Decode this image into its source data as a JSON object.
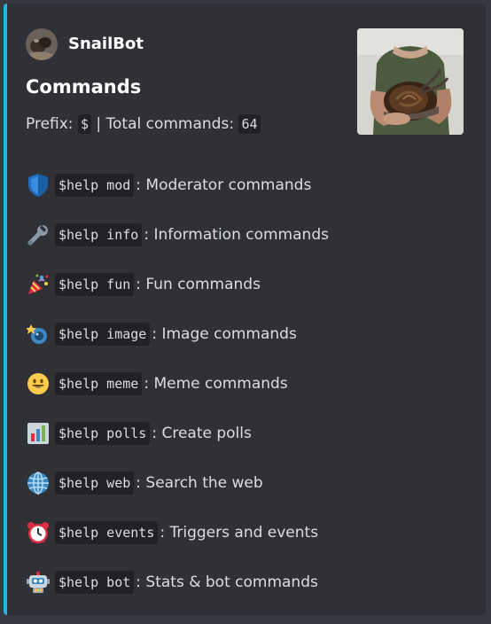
{
  "colors": {
    "background": "#36393f",
    "embed_background": "#2f3136",
    "accent": "#23b4e6",
    "code_background": "#202225",
    "text": "#dcddde",
    "title": "#ffffff"
  },
  "author": {
    "name": "SnailBot",
    "avatar_icon": "snail-avatar"
  },
  "embed": {
    "title": "Commands",
    "prefix_label": "Prefix:",
    "prefix_value": "$",
    "separator": "| Total commands:",
    "total_commands": "64",
    "thumbnail": "snail-photo"
  },
  "commands": [
    {
      "icon": "shield-icon",
      "code": "$help mod",
      "description": ": Moderator commands"
    },
    {
      "icon": "wrench-icon",
      "code": "$help info",
      "description": ": Information commands"
    },
    {
      "icon": "party-popper-icon",
      "code": "$help fun",
      "description": ": Fun commands"
    },
    {
      "icon": "camera-flash-icon",
      "code": "$help image",
      "description": ": Image commands"
    },
    {
      "icon": "smiley-icon",
      "code": "$help meme",
      "description": ": Meme commands"
    },
    {
      "icon": "bar-chart-icon",
      "code": "$help polls",
      "description": ": Create polls"
    },
    {
      "icon": "globe-icon",
      "code": "$help web",
      "description": ": Search the web"
    },
    {
      "icon": "alarm-clock-icon",
      "code": "$help events",
      "description": ": Triggers and events"
    },
    {
      "icon": "robot-icon",
      "code": "$help bot",
      "description": ": Stats & bot commands"
    }
  ]
}
